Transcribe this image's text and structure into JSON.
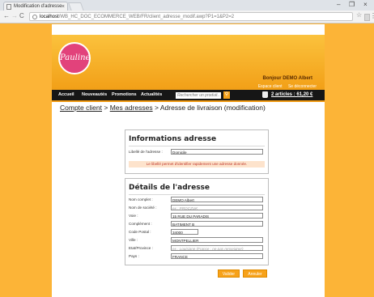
{
  "browser": {
    "tab_title": "Modification d'adresse",
    "tab_close": "×",
    "url_host": "localhost",
    "url_path": "/WB_HC_DOC_ECOMMERCE_WEB/FR/client_adresse_modif.awp?P1=1&P2=2",
    "window_controls": {
      "minimize": "–",
      "maximize": "❐",
      "close": "×"
    },
    "back": "←",
    "forward": "→",
    "reload": "C",
    "star": "☆",
    "menu": "⋮"
  },
  "header": {
    "logo_text": "Pauline",
    "greeting": "Bonjour DEMO Albert",
    "account_link": "Espace client",
    "logout_link": "Se déconnecter"
  },
  "nav": {
    "items": [
      "Accueil",
      "Nouveautés",
      "Promotions",
      "Actualités"
    ],
    "search_placeholder": "Rechercher un produit...",
    "cart": "2 articles : 61,20 €"
  },
  "breadcrumb": {
    "account": "Compte client",
    "sep": ">",
    "addresses": "Mes adresses",
    "current": "Adresse de livraison (modification)"
  },
  "info_section": {
    "title": "Informations adresse",
    "label_field_label": "Libellé de l'adresse :",
    "label_field_value": "Domicile",
    "hint": "Le libellé permet d'identifier rapidement une adresse donnée."
  },
  "detail_section": {
    "title": "Détails de l'adresse",
    "fields": [
      {
        "label": "Nom complet :",
        "value": "DEMO Albert",
        "placeholder": false
      },
      {
        "label": "Nom de société :",
        "value": "ex : PROCZUK",
        "placeholder": true
      },
      {
        "label": "Voie :",
        "value": "15 RUE DU PARADIS",
        "placeholder": false
      },
      {
        "label": "Complément :",
        "value": "BATIMENT B",
        "placeholder": false
      },
      {
        "label": "Code Postal :",
        "value": "34000",
        "placeholder": false
      },
      {
        "label": "Ville :",
        "value": "MONTPELLIER",
        "placeholder": false
      },
      {
        "label": "Etat/Province :",
        "value": "ex : Louisiane (France : ne pas renseigner)",
        "placeholder": true
      },
      {
        "label": "Pays :",
        "value": "FRANCE",
        "placeholder": false
      }
    ]
  },
  "actions": {
    "validate": "Valider",
    "cancel": "Annuler"
  }
}
